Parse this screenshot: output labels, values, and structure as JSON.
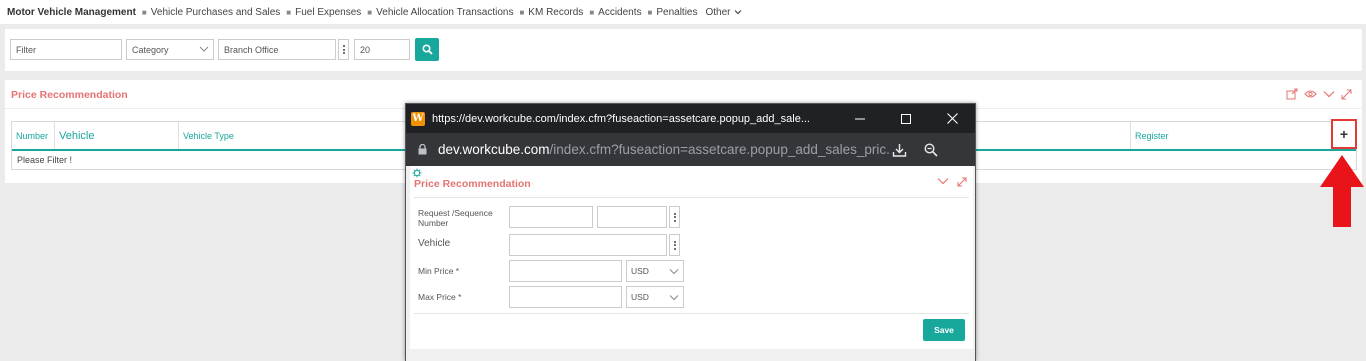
{
  "nav": {
    "brand": "Motor Vehicle Management",
    "items": [
      "Vehicle Purchases and Sales",
      "Fuel Expenses",
      "Vehicle Allocation Transactions",
      "KM Records",
      "Accidents",
      "Penalties"
    ],
    "other": "Other"
  },
  "filters": {
    "filter_placeholder": "Filter",
    "category": "Category",
    "branch_office": "Branch Office",
    "page_size": "20"
  },
  "panel": {
    "title": "Price Recommendation",
    "columns": [
      "Number",
      "Vehicle",
      "Vehicle Type",
      "Register"
    ],
    "empty_text": "Please Filter !",
    "add_symbol": "+"
  },
  "popup": {
    "logo": "W",
    "window_title": "https://dev.workcube.com/index.cfm?fuseaction=assetcare.popup_add_sale...",
    "url_host": "dev.workcube.com",
    "url_path": "/index.cfm?fuseaction=assetcare.popup_add_sales_pric...",
    "form_title": "Price Recommendation",
    "labels": {
      "request": "Request /Sequence Number",
      "vehicle": "Vehicle",
      "min_price": "Min Price *",
      "max_price": "Max Price *"
    },
    "currency_min": "USD",
    "currency_max": "USD",
    "save": "Save"
  },
  "colors": {
    "accent": "#18a89b",
    "title_red": "#e57373",
    "highlight_red": "#e53935"
  }
}
